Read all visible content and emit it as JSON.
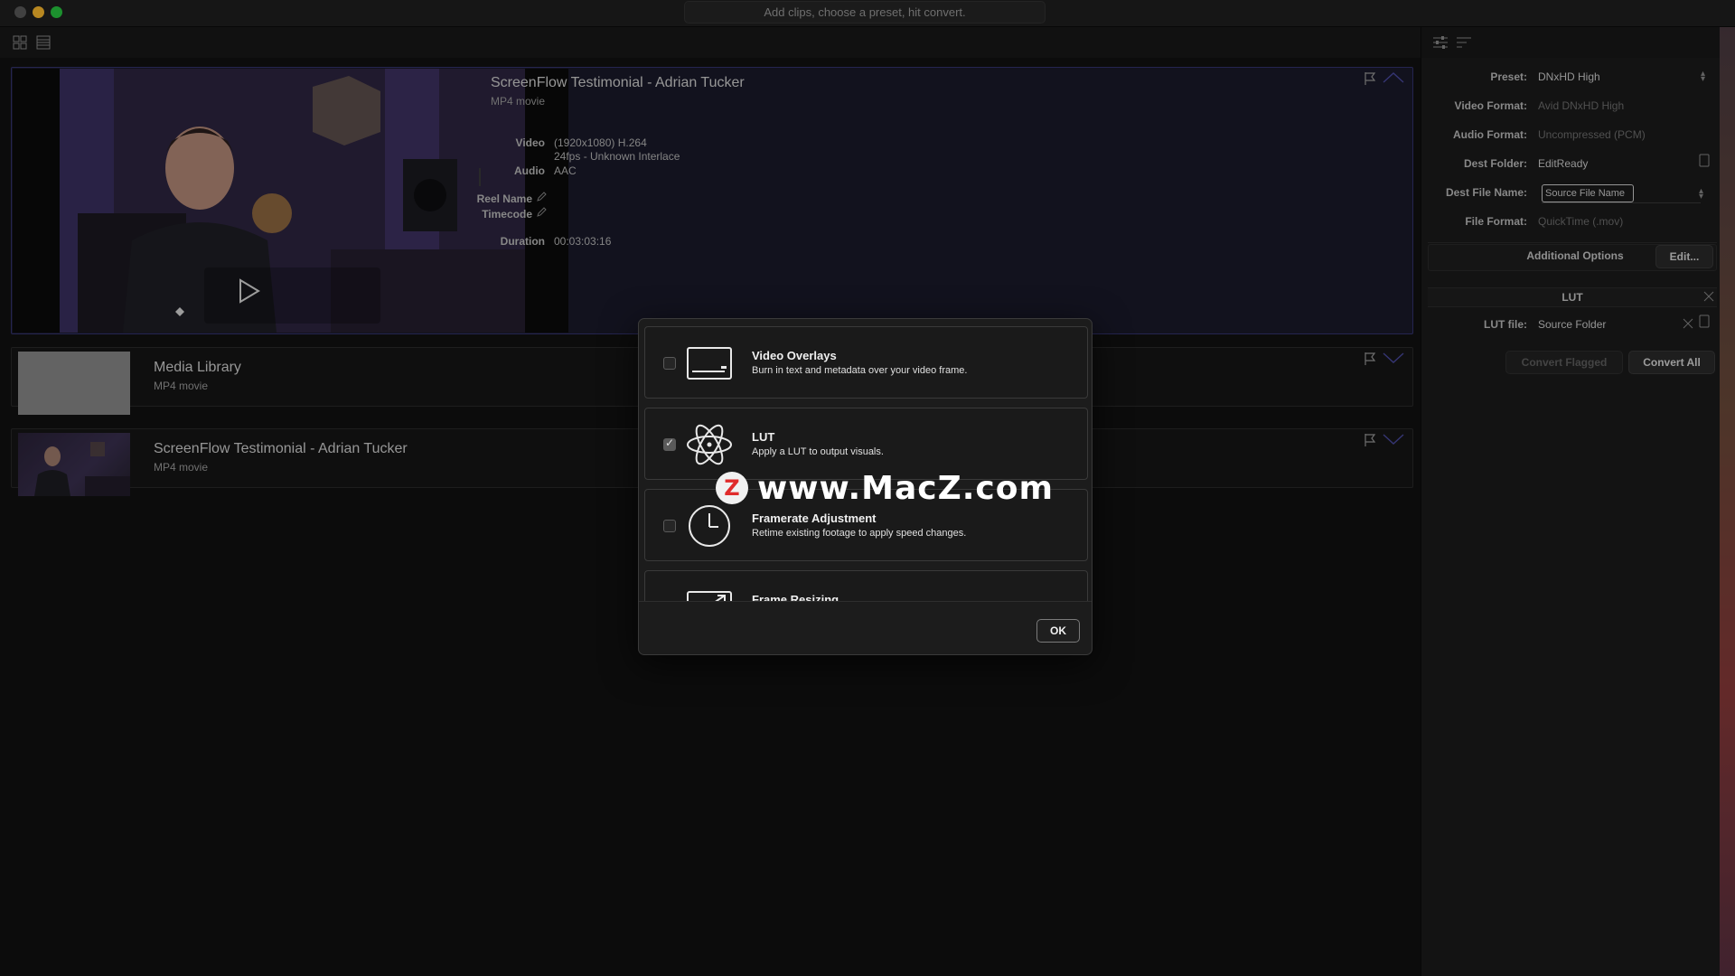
{
  "window": {
    "title_hint": "Add clips, choose a preset, hit convert."
  },
  "clips": [
    {
      "title": "ScreenFlow Testimonial - Adrian Tucker",
      "subtitle": "MP4 movie",
      "video_label": "Video",
      "video_line1": "(1920x1080) H.264",
      "video_line2": "24fps - Unknown Interlace",
      "audio_label": "Audio",
      "audio_value": "AAC",
      "reel_label": "Reel Name",
      "timecode_label": "Timecode",
      "duration_label": "Duration",
      "duration_value": "00:03:03:16"
    },
    {
      "title": "Media Library",
      "subtitle": "MP4 movie"
    },
    {
      "title": "ScreenFlow Testimonial - Adrian Tucker",
      "subtitle": "MP4 movie"
    }
  ],
  "sidebar": {
    "preset_label": "Preset:",
    "preset_value": "DNxHD High",
    "video_format_label": "Video Format:",
    "video_format_value": "Avid DNxHD High",
    "audio_format_label": "Audio Format:",
    "audio_format_value": "Uncompressed (PCM)",
    "dest_folder_label": "Dest Folder:",
    "dest_folder_value": "EditReady",
    "dest_file_label": "Dest File Name:",
    "dest_file_value": "Source File Name",
    "file_format_label": "File Format:",
    "file_format_value": "QuickTime (.mov)",
    "additional_options_label": "Additional Options",
    "edit_button": "Edit...",
    "lut_section": "LUT",
    "lut_file_label": "LUT file:",
    "lut_file_value": "Source Folder",
    "convert_flagged": "Convert Flagged",
    "convert_all": "Convert All"
  },
  "modal": {
    "options": [
      {
        "title": "Video Overlays",
        "desc": "Burn in text and metadata over your video frame.",
        "checked": false,
        "icon": "overlay-icon"
      },
      {
        "title": "LUT",
        "desc": "Apply a LUT to output visuals.",
        "checked": true,
        "icon": "atom-icon"
      },
      {
        "title": "Framerate Adjustment",
        "desc": "Retime existing footage to apply speed changes.",
        "checked": false,
        "icon": "clock-icon"
      },
      {
        "title": "Frame Resizing",
        "desc": "",
        "checked": false,
        "icon": "resize-icon"
      }
    ],
    "ok_label": "OK"
  },
  "watermark": {
    "logo": "Z",
    "text": "www.MacZ.com"
  },
  "colors": {
    "selected_border": "#343470",
    "accent_chevron": "#4a4aa0"
  }
}
